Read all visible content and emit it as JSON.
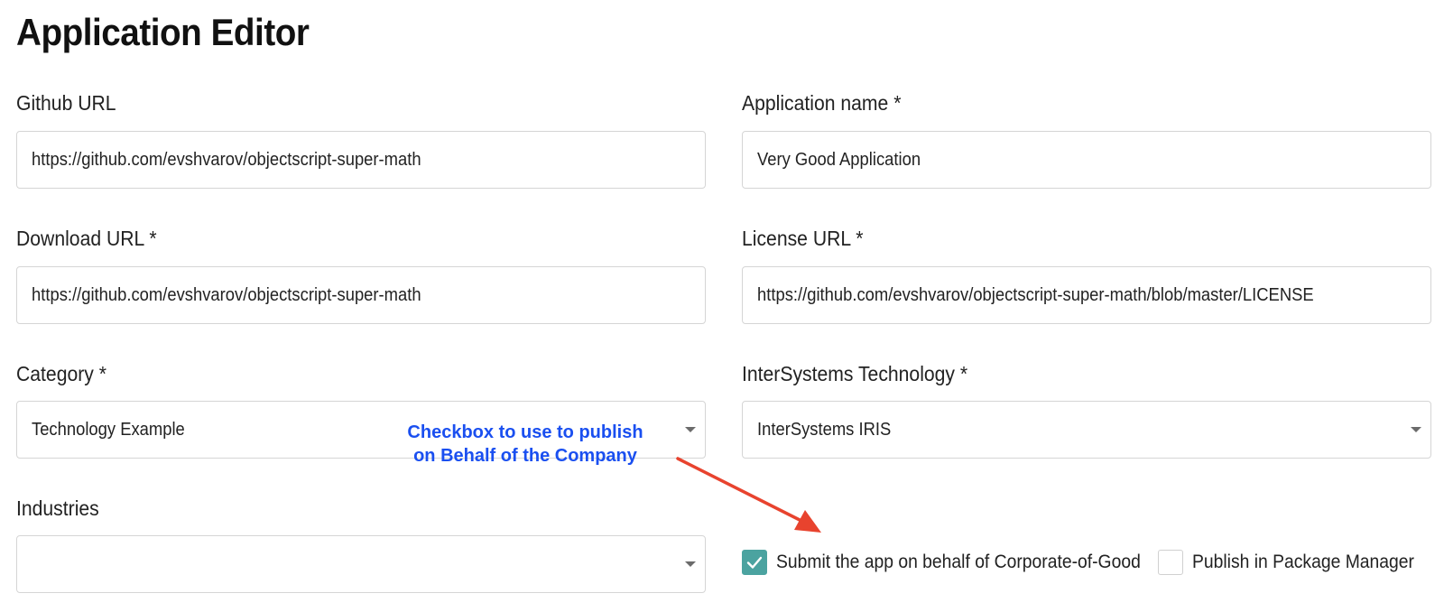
{
  "page": {
    "title": "Application Editor"
  },
  "form": {
    "github_url": {
      "label": "Github URL",
      "value": "https://github.com/evshvarov/objectscript-super-math"
    },
    "application_name": {
      "label": "Application name *",
      "value": "Very Good Application"
    },
    "download_url": {
      "label": "Download URL *",
      "value": "https://github.com/evshvarov/objectscript-super-math"
    },
    "license_url": {
      "label": "License URL *",
      "value": "https://github.com/evshvarov/objectscript-super-math/blob/master/LICENSE"
    },
    "category": {
      "label": "Category *",
      "value": "Technology Example"
    },
    "intersystems_technology": {
      "label": "InterSystems Technology *",
      "value": "InterSystems IRIS"
    },
    "industries": {
      "label": "Industries",
      "value": ""
    },
    "submit_on_behalf": {
      "label": "Submit the app on behalf of Corporate-of-Good",
      "checked": true
    },
    "publish_package_manager": {
      "label": "Publish in Package Manager",
      "checked": false
    }
  },
  "annotation": {
    "line1": "Checkbox to use to publish",
    "line2": "on Behalf of the Company",
    "text_color": "#1a4ff0",
    "arrow_color": "#e8432e"
  },
  "colors": {
    "checkbox_checked": "#4ba3a0",
    "border": "#d5d5d5"
  },
  "icons": {
    "select_arrow": "chevron-down-icon",
    "checkmark": "checkmark-icon",
    "annotation_arrow": "arrow-icon"
  }
}
